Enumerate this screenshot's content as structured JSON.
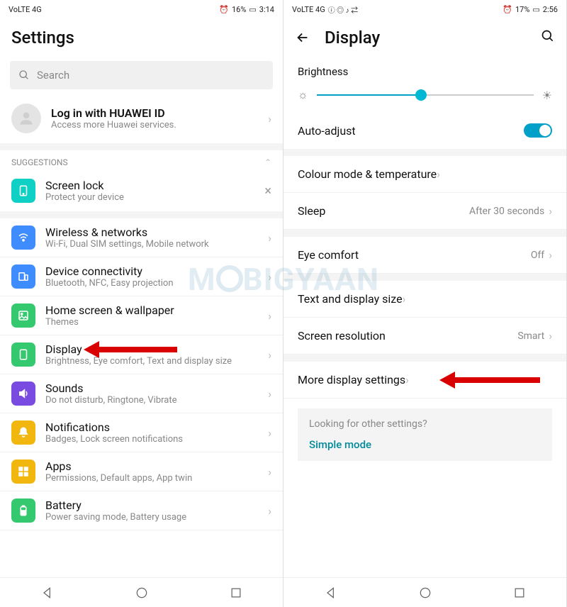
{
  "left": {
    "status": {
      "net": "VoLTE 4G",
      "battery": "16%",
      "time": "3:14"
    },
    "title": "Settings",
    "search_placeholder": "Search",
    "login": {
      "title": "Log in with HUAWEI ID",
      "sub": "Access more Huawei services."
    },
    "suggestions_label": "SUGGESTIONS",
    "suggestion": {
      "title": "Screen lock",
      "sub": "Protect your device"
    },
    "items": [
      {
        "icon_color": "#3f8cff",
        "icon": "wifi",
        "title": "Wireless & networks",
        "sub": "Wi-Fi, Dual SIM settings, Mobile network"
      },
      {
        "icon_color": "#3f8cff",
        "icon": "devices",
        "title": "Device connectivity",
        "sub": "Bluetooth, NFC, Easy projection"
      },
      {
        "icon_color": "#34c96f",
        "icon": "image",
        "title": "Home screen & wallpaper",
        "sub": "Themes"
      },
      {
        "icon_color": "#34c96f",
        "icon": "display",
        "title": "Display",
        "sub": "Brightness, Eye comfort, Text and display size",
        "arrow": true
      },
      {
        "icon_color": "#7a4be0",
        "icon": "sound",
        "title": "Sounds",
        "sub": "Do not disturb, Ringtone, Vibrate"
      },
      {
        "icon_color": "#f2b70f",
        "icon": "bell",
        "title": "Notifications",
        "sub": "Badges, Lock screen notifications"
      },
      {
        "icon_color": "#f2b70f",
        "icon": "apps",
        "title": "Apps",
        "sub": "Permissions, Default apps, App twin"
      },
      {
        "icon_color": "#34c96f",
        "icon": "battery",
        "title": "Battery",
        "sub": "Power saving mode, Battery usage"
      }
    ]
  },
  "right": {
    "status": {
      "net": "VoLTE 4G",
      "battery": "17%",
      "time": "2:56"
    },
    "title": "Display",
    "brightness_label": "Brightness",
    "brightness_pct": 48,
    "auto_adjust_label": "Auto-adjust",
    "auto_adjust": true,
    "rows": [
      {
        "label": "Colour mode & temperature",
        "value": ""
      },
      {
        "label": "Sleep",
        "value": "After 30 seconds"
      },
      {
        "sep": true
      },
      {
        "label": "Eye comfort",
        "value": "Off"
      },
      {
        "sep": true
      },
      {
        "label": "Text and display size",
        "value": ""
      },
      {
        "label": "Screen resolution",
        "value": "Smart"
      },
      {
        "sep": true
      },
      {
        "label": "More display settings",
        "value": "",
        "arrow": true
      }
    ],
    "hint_q": "Looking for other settings?",
    "hint_link": "Simple mode"
  },
  "watermark": "MOBIGYAAN"
}
